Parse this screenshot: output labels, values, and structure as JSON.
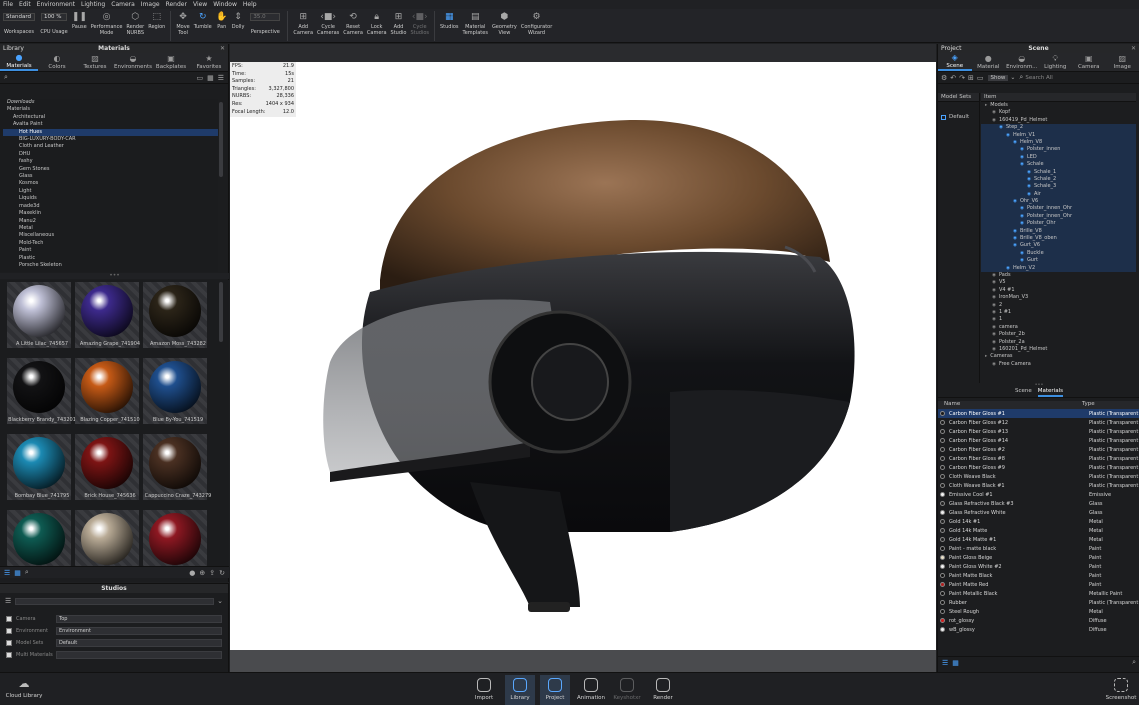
{
  "menu": [
    "File",
    "Edit",
    "Environment",
    "Lighting",
    "Camera",
    "Image",
    "Render",
    "View",
    "Window",
    "Help"
  ],
  "toolbar": {
    "workspace_value": "Standard",
    "workspaces_label": "Workspaces",
    "cpu_value": "100 %",
    "cpu_label": "CPU Usage",
    "pause": "Pause",
    "performance": "Performance\nMode",
    "render_nurbs": "Render\nNURBS",
    "region": "Region",
    "move_tool": "Move\nTool",
    "tumble": "Tumble",
    "pan": "Pan",
    "dolly": "Dolly",
    "perspective": "Perspective",
    "zoom_value": "35.0",
    "add_camera": "Add\nCamera",
    "cycle_cameras": "Cycle\nCameras",
    "reset_camera": "Reset\nCamera",
    "lock_camera": "Lock\nCamera",
    "add_studio": "Add\nStudio",
    "cycle_studios": "Cycle\nStudios",
    "studios": "Studios",
    "material_templates": "Material\nTemplates",
    "geometry_view": "Geometry\nView",
    "configurator_wizard": "Configurator\nWizard"
  },
  "library": {
    "header_left": "Library",
    "header_title": "Materials",
    "tabs": [
      "Materials",
      "Colors",
      "Textures",
      "Environments",
      "Backplates",
      "Favorites"
    ],
    "tree": [
      "Downloads",
      "Materials",
      "Architectural",
      "Avalta Paint",
      "Hot Hues",
      "BIG-LUXURY-BODY-CAR",
      "Cloth and Leather",
      "DHU",
      "fashy",
      "Gem Stones",
      "Glass",
      "Kosmos",
      "Light",
      "Liquids",
      "made3d",
      "Maxeklin",
      "Manu2",
      "Metal",
      "Miscellaneous",
      "Mold-Tech",
      "Paint",
      "Plastic",
      "Porsche Skeleton"
    ],
    "swatches": [
      {
        "name": "A Little Lilac_745657",
        "color": "#bfc0d6"
      },
      {
        "name": "Amazing Grape_741904",
        "color": "#3d2a8c"
      },
      {
        "name": "Amazon Moss_743282",
        "color": "#2b2418"
      },
      {
        "name": "Blackberry Brandy_743201",
        "color": "#121214"
      },
      {
        "name": "Blazing Copper_741510",
        "color": "#c65a16"
      },
      {
        "name": "Blue By-You_741519",
        "color": "#1f4f8e"
      },
      {
        "name": "Bombay Blue_741795",
        "color": "#1c8ab3"
      },
      {
        "name": "Brick House_745636",
        "color": "#7d1414"
      },
      {
        "name": "Cappuccino Craze_743279",
        "color": "#4a3022"
      },
      {
        "name": "",
        "color": "#0e5b52"
      },
      {
        "name": "",
        "color": "#b9ab96"
      },
      {
        "name": "",
        "color": "#8e1822"
      }
    ]
  },
  "studios": {
    "title": "Studios",
    "rows": [
      {
        "label": "Camera",
        "value": "Top"
      },
      {
        "label": "Environment",
        "value": "Environment"
      },
      {
        "label": "Model Sets",
        "value": "Default"
      },
      {
        "label": "Multi Materials",
        "value": ""
      }
    ]
  },
  "viewport": {
    "stats": [
      [
        "FPS:",
        "21.9"
      ],
      [
        "Time:",
        "15s"
      ],
      [
        "Samples:",
        "21"
      ],
      [
        "Triangles:",
        "3,327,800"
      ],
      [
        "NURBS:",
        "28,336"
      ],
      [
        "Res:",
        "1404 x 934"
      ],
      [
        "Focal Length:",
        "12.0"
      ]
    ]
  },
  "scene": {
    "header_left": "Project",
    "header_title": "Scene",
    "tabs": [
      "Scene",
      "Material",
      "Environm...",
      "Lighting",
      "Camera",
      "Image"
    ],
    "show_label": "Show",
    "search_placeholder": "Search All",
    "model_sets_label": "Model Sets",
    "item_label": "Item",
    "default_set": "Default",
    "tree": [
      {
        "t": "Models",
        "d": 0
      },
      {
        "t": "Kopf",
        "d": 1
      },
      {
        "t": "160419_Pd_Helmet",
        "d": 1
      },
      {
        "t": "Step_2",
        "d": 2
      },
      {
        "t": "Helm_V1",
        "d": 3
      },
      {
        "t": "Helm_V8",
        "d": 4
      },
      {
        "t": "Polster_innen",
        "d": 5
      },
      {
        "t": "LED",
        "d": 5
      },
      {
        "t": "Schale",
        "d": 5
      },
      {
        "t": "Schale_1",
        "d": 6
      },
      {
        "t": "Schale_2",
        "d": 6
      },
      {
        "t": "Schale_3",
        "d": 6
      },
      {
        "t": "Air",
        "d": 6
      },
      {
        "t": "Ohr_V6",
        "d": 4
      },
      {
        "t": "Polster_innen_Ohr",
        "d": 5
      },
      {
        "t": "Polster_innen_Ohr",
        "d": 5
      },
      {
        "t": "Polster_Ohr",
        "d": 5
      },
      {
        "t": "Brille_V8",
        "d": 4
      },
      {
        "t": "Brille_V8_oben",
        "d": 4
      },
      {
        "t": "Gurt_V6",
        "d": 4
      },
      {
        "t": "Buckle",
        "d": 5
      },
      {
        "t": "Gurt",
        "d": 5
      },
      {
        "t": "Helm_V2",
        "d": 3
      },
      {
        "t": "Pads",
        "d": 1
      },
      {
        "t": "V5",
        "d": 1
      },
      {
        "t": "V4 #1",
        "d": 1
      },
      {
        "t": "IronMan_V3",
        "d": 1
      },
      {
        "t": "2",
        "d": 1
      },
      {
        "t": "1 #1",
        "d": 1
      },
      {
        "t": "1",
        "d": 1
      },
      {
        "t": "camera",
        "d": 1
      },
      {
        "t": "Polster_2b",
        "d": 1
      },
      {
        "t": "Polster_2a",
        "d": 1
      },
      {
        "t": "160201_Pd_Helmet",
        "d": 1
      },
      {
        "t": "Cameras",
        "d": 0
      },
      {
        "t": "Free Camera",
        "d": 1
      }
    ],
    "subtabs": [
      "Scene",
      "Materials"
    ],
    "col_name": "Name",
    "col_type": "Type",
    "materials": [
      {
        "n": "Carbon Fiber Gloss #1",
        "t": "Plastic (Transparent",
        "c": "#1a1a1a",
        "sel": true
      },
      {
        "n": "Carbon Fiber Gloss #12",
        "t": "Plastic (Transparent",
        "c": "#1a1a1a"
      },
      {
        "n": "Carbon Fiber Gloss #13",
        "t": "Plastic (Transparent",
        "c": "#1a1a1a"
      },
      {
        "n": "Carbon Fiber Gloss #14",
        "t": "Plastic (Transparent",
        "c": "#1a1a1a"
      },
      {
        "n": "Carbon Fiber Gloss #2",
        "t": "Plastic (Transparent",
        "c": "#1a1a1a"
      },
      {
        "n": "Carbon Fiber Gloss #8",
        "t": "Plastic (Transparent",
        "c": "#1a1a1a"
      },
      {
        "n": "Carbon Fiber Gloss #9",
        "t": "Plastic (Transparent",
        "c": "#1a1a1a"
      },
      {
        "n": "Cloth Weave Black",
        "t": "Plastic (Transparent",
        "c": "#1a1a1a"
      },
      {
        "n": "Cloth Weave Black #1",
        "t": "Plastic (Transparent",
        "c": "#1a1a1a"
      },
      {
        "n": "Emissive Cool #1",
        "t": "Emissive",
        "c": "#f5f5f5"
      },
      {
        "n": "Glass Refractive Black #3",
        "t": "Glass",
        "c": "#222"
      },
      {
        "n": "Glass Refractive White",
        "t": "Glass",
        "c": "#eee"
      },
      {
        "n": "Gold 14k #1",
        "t": "Metal",
        "c": "#222"
      },
      {
        "n": "Gold 14k Matte",
        "t": "Metal",
        "c": "#222"
      },
      {
        "n": "Gold 14k Matte #1",
        "t": "Metal",
        "c": "#222"
      },
      {
        "n": "Paint - matte black",
        "t": "Paint",
        "c": "#111"
      },
      {
        "n": "Paint Gloss Beige",
        "t": "Paint",
        "c": "#e8e0c8"
      },
      {
        "n": "Paint Gloss White #2",
        "t": "Paint",
        "c": "#f2f2f2"
      },
      {
        "n": "Paint Matte Black",
        "t": "Paint",
        "c": "#111"
      },
      {
        "n": "Paint Matte Red",
        "t": "Paint",
        "c": "#b01d1d"
      },
      {
        "n": "Paint Metallic Black",
        "t": "Metallic Paint",
        "c": "#111"
      },
      {
        "n": "Rubber",
        "t": "Plastic (Transparent",
        "c": "#111"
      },
      {
        "n": "Steel Rough",
        "t": "Metal",
        "c": "#111"
      },
      {
        "n": "rot_glossy",
        "t": "Diffuse",
        "c": "#d11a1a"
      },
      {
        "n": "wB_glossy",
        "t": "Diffuse",
        "c": "#f0f0f0"
      }
    ]
  },
  "bottom": {
    "cloud": "Cloud Library",
    "buttons": [
      "Import",
      "Library",
      "Project",
      "Animation",
      "Keyshotxr",
      "Render"
    ],
    "screenshot": "Screenshot"
  },
  "colors": {
    "accent": "#3d8fe0",
    "helmet_brown": "#6b4a2e",
    "helmet_black": "#121316"
  }
}
